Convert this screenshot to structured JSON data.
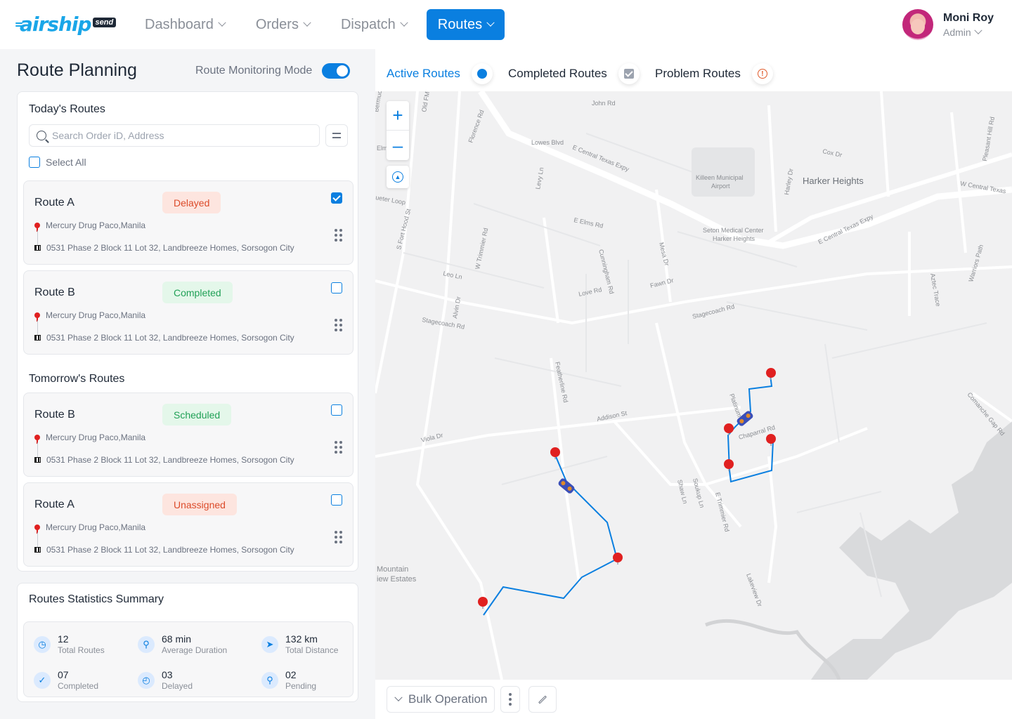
{
  "brand": {
    "logo_text": "airship",
    "logo_badge": "send"
  },
  "nav": {
    "items": [
      {
        "label": "Dashboard"
      },
      {
        "label": "Orders"
      },
      {
        "label": "Dispatch"
      },
      {
        "label": "Routes"
      }
    ],
    "active": "Routes"
  },
  "user": {
    "name": "Moni Roy",
    "role": "Admin"
  },
  "page": {
    "title": "Route Planning",
    "mode_label": "Route Monitoring Mode",
    "mode_on": true
  },
  "today": {
    "title": "Today's Routes",
    "search_placeholder": "Search Order iD,  Address",
    "select_all": "Select All",
    "routes": [
      {
        "name": "Route A",
        "status": "Delayed",
        "checked": true,
        "pickup": "Mercury Drug Paco,Manila",
        "dropoff": "0531 Phase 2 Block 11 Lot 32, Landbreeze Homes, Sorsogon City"
      },
      {
        "name": "Route B",
        "status": "Completed",
        "checked": false,
        "pickup": "Mercury Drug Paco,Manila",
        "dropoff": "0531 Phase 2 Block 11 Lot 32, Landbreeze Homes, Sorsogon City"
      }
    ]
  },
  "tomorrow": {
    "title": "Tomorrow's Routes",
    "routes": [
      {
        "name": "Route B",
        "status": "Scheduled",
        "checked": false,
        "pickup": "Mercury Drug Paco,Manila",
        "dropoff": "0531 Phase 2 Block 11 Lot 32, Landbreeze Homes, Sorsogon City"
      },
      {
        "name": "Route A",
        "status": "Unassigned",
        "checked": false,
        "pickup": "Mercury Drug Paco,Manila",
        "dropoff": "0531 Phase 2 Block 11 Lot 32, Landbreeze Homes, Sorsogon City"
      }
    ]
  },
  "stats": {
    "title": "Routes Statistics Summary",
    "items": [
      {
        "value": "12",
        "label": "Total Routes",
        "icon": "clock-icon"
      },
      {
        "value": "68 min",
        "label": "Average Duration",
        "icon": "location-pin-icon"
      },
      {
        "value": "132 km",
        "label": "Total Distance",
        "icon": "navigation-arrow-icon"
      },
      {
        "value": "07",
        "label": "Completed",
        "icon": "check-circle-icon"
      },
      {
        "value": "03",
        "label": "Delayed",
        "icon": "delay-clock-icon"
      },
      {
        "value": "02",
        "label": "Pending",
        "icon": "pending-search-icon"
      }
    ]
  },
  "map_tabs": [
    {
      "label": "Active Routes",
      "icon": "active-dot-icon"
    },
    {
      "label": "Completed Routes",
      "icon": "checkbox-icon"
    },
    {
      "label": "Problem Routes",
      "icon": "warning-icon"
    }
  ],
  "map": {
    "place_labels": [
      "Harker Heights",
      "Killeen Municipal",
      "Airport",
      "Seton Medical Center",
      "Harker Heights",
      "Mountain",
      "iew Estates"
    ],
    "street_labels": [
      "John Rd",
      "Lowes Blvd",
      "E Central Texas Expy",
      "Florence Rd",
      "Old FM",
      "Levy Ln",
      "E Elms Rd",
      "S Fort Hood St",
      "W Trimmier Rd",
      "Leo Ln",
      "Cunningham Rd",
      "Mesa Dr",
      "Love Rd",
      "Fawn Dr",
      "Stagecoach Rd",
      "Stagecoach Rd",
      "Alvin Dr",
      "Cox Dr",
      "W Central Texas",
      "Pleasant Hill Rd",
      "Harley Dr",
      "E Central Texas Expy",
      "Aztec Trace",
      "Warriors Path",
      "Featherline Rd",
      "Addison St",
      "Viola Dr",
      "Platinum",
      "Chaparral Rd",
      "Shaw Ln",
      "Soukup Ln",
      "E Trimmier Rd",
      "Comanche Gap Rd",
      "Lakeview Dr",
      "ueter Loop",
      "Elm",
      "Bermud"
    ],
    "route_color": "#0a7fe0",
    "pin_color": "#e02020"
  },
  "bottom": {
    "bulk_label": "Bulk Operation"
  },
  "colors": {
    "accent": "#0a7fe0",
    "delayed": "#dc4b2a",
    "completed": "#21a157"
  }
}
